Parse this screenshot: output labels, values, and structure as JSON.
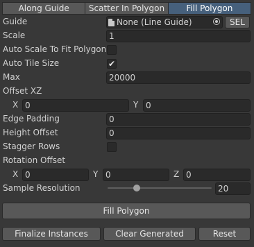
{
  "tabs": [
    {
      "label": "Along Guide",
      "active": false
    },
    {
      "label": "Scatter In Polygon",
      "active": false
    },
    {
      "label": "Fill Polygon",
      "active": true
    }
  ],
  "guide": {
    "label": "Guide",
    "value": "None (Line Guide)",
    "sel_label": "SEL"
  },
  "scale": {
    "label": "Scale",
    "value": "1"
  },
  "auto_scale": {
    "label": "Auto Scale To Fit Polygon",
    "checked": false
  },
  "auto_tile": {
    "label": "Auto Tile Size",
    "checked": true,
    "mark": "✔"
  },
  "max": {
    "label": "Max",
    "value": "20000"
  },
  "offset_xz": {
    "label": "Offset XZ",
    "x_label": "X",
    "x_value": "0",
    "y_label": "Y",
    "y_value": "0"
  },
  "edge_padding": {
    "label": "Edge Padding",
    "value": "0"
  },
  "height_offset": {
    "label": "Height Offset",
    "value": "0"
  },
  "stagger_rows": {
    "label": "Stagger Rows",
    "checked": false
  },
  "rotation_offset": {
    "label": "Rotation Offset",
    "x_label": "X",
    "x_value": "0",
    "y_label": "Y",
    "y_value": "0",
    "z_label": "Z",
    "z_value": "0"
  },
  "sample_resolution": {
    "label": "Sample Resolution",
    "value": "20",
    "slider_fraction": 0.28
  },
  "buttons": {
    "fill_polygon": "Fill Polygon",
    "finalize": "Finalize Instances",
    "clear": "Clear Generated",
    "reset": "Reset"
  },
  "colors": {
    "background": "#383838",
    "active_tab": "#46607c",
    "field": "#2a2a2a",
    "button": "#585858"
  }
}
